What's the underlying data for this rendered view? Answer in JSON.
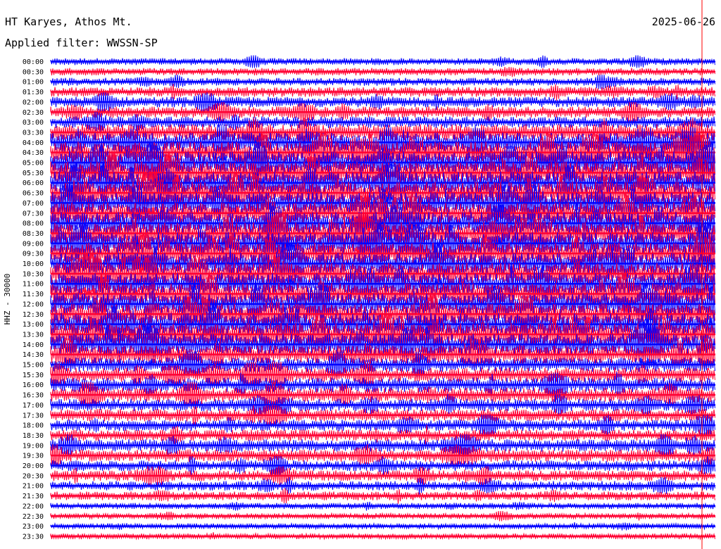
{
  "header": {
    "station": "HT Karyes, Athos Mt.",
    "date": "2025-06-26",
    "filter_label": "Applied filter:",
    "filter_value": "WWSSN-SP"
  },
  "chart_data": {
    "type": "line",
    "title": "HT Karyes, Athos Mt.",
    "date": "2025-06-26",
    "filter": "WWSSN-SP",
    "ylabel": "HHZ - 30000",
    "row_labels": [
      "00:00",
      "00:30",
      "01:00",
      "01:30",
      "02:00",
      "02:30",
      "03:00",
      "03:30",
      "04:00",
      "04:30",
      "05:00",
      "05:30",
      "06:00",
      "06:30",
      "07:00",
      "07:30",
      "08:00",
      "08:30",
      "09:00",
      "09:30",
      "10:00",
      "10:30",
      "11:00",
      "11:30",
      "12:00",
      "12:30",
      "13:00",
      "13:30",
      "14:00",
      "14:30",
      "15:00",
      "15:30",
      "16:00",
      "16:30",
      "17:00",
      "17:30",
      "18:00",
      "18:30",
      "19:00",
      "19:30",
      "20:00",
      "20:30",
      "21:00",
      "21:30",
      "22:00",
      "22:30",
      "23:00",
      "23:30"
    ],
    "series_colors": [
      "#0000ff",
      "#ff0033"
    ],
    "relative_amplitude": [
      0.15,
      0.18,
      0.2,
      0.3,
      0.35,
      0.38,
      0.4,
      0.65,
      0.85,
      0.95,
      1.0,
      1.0,
      1.0,
      1.0,
      0.95,
      0.95,
      1.0,
      1.0,
      1.0,
      0.95,
      0.95,
      0.95,
      0.95,
      0.95,
      0.95,
      0.95,
      1.0,
      1.0,
      0.95,
      0.75,
      0.55,
      0.55,
      0.55,
      0.55,
      0.45,
      0.45,
      0.4,
      0.4,
      0.45,
      0.45,
      0.35,
      0.35,
      0.3,
      0.25,
      0.1,
      0.08,
      0.08,
      0.08
    ],
    "grid": false,
    "marker_color": "#ff0000"
  }
}
